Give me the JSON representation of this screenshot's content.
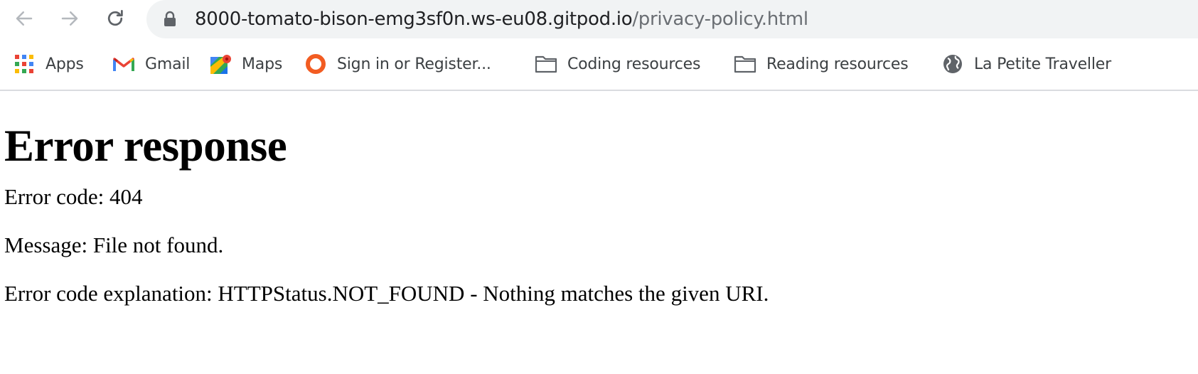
{
  "browser": {
    "url_host": "8000-tomato-bison-emg3sf0n.ws-eu08.gitpod.io",
    "url_path": "/privacy-policy.html",
    "nav_icons": {
      "back": "arrow-left-icon",
      "forward": "arrow-right-icon",
      "reload": "reload-icon",
      "secure": "lock-icon"
    }
  },
  "bookmarks": [
    {
      "label": "Apps",
      "icon": "apps-grid-icon"
    },
    {
      "label": "Gmail",
      "icon": "gmail-icon"
    },
    {
      "label": "Maps",
      "icon": "maps-icon"
    },
    {
      "label": "Sign in or Register...",
      "icon": "ring-logo-icon"
    },
    {
      "label": "Coding resources",
      "icon": "folder-icon"
    },
    {
      "label": "Reading resources",
      "icon": "folder-icon"
    },
    {
      "label": "La Petite Traveller",
      "icon": "globe-icon"
    }
  ],
  "page": {
    "heading": "Error response",
    "lines": [
      "Error code: 404",
      "Message: File not found.",
      "Error code explanation: HTTPStatus.NOT_FOUND - Nothing matches the given URI."
    ]
  },
  "colors": {
    "omnibox_bg": "#f1f3f4",
    "url_host": "#202124",
    "url_path": "#6a6e73",
    "bookmark_text": "#3c4043",
    "divider": "#dadce0",
    "icon_disabled": "#9aa0a6",
    "icon_active": "#5f6368"
  }
}
